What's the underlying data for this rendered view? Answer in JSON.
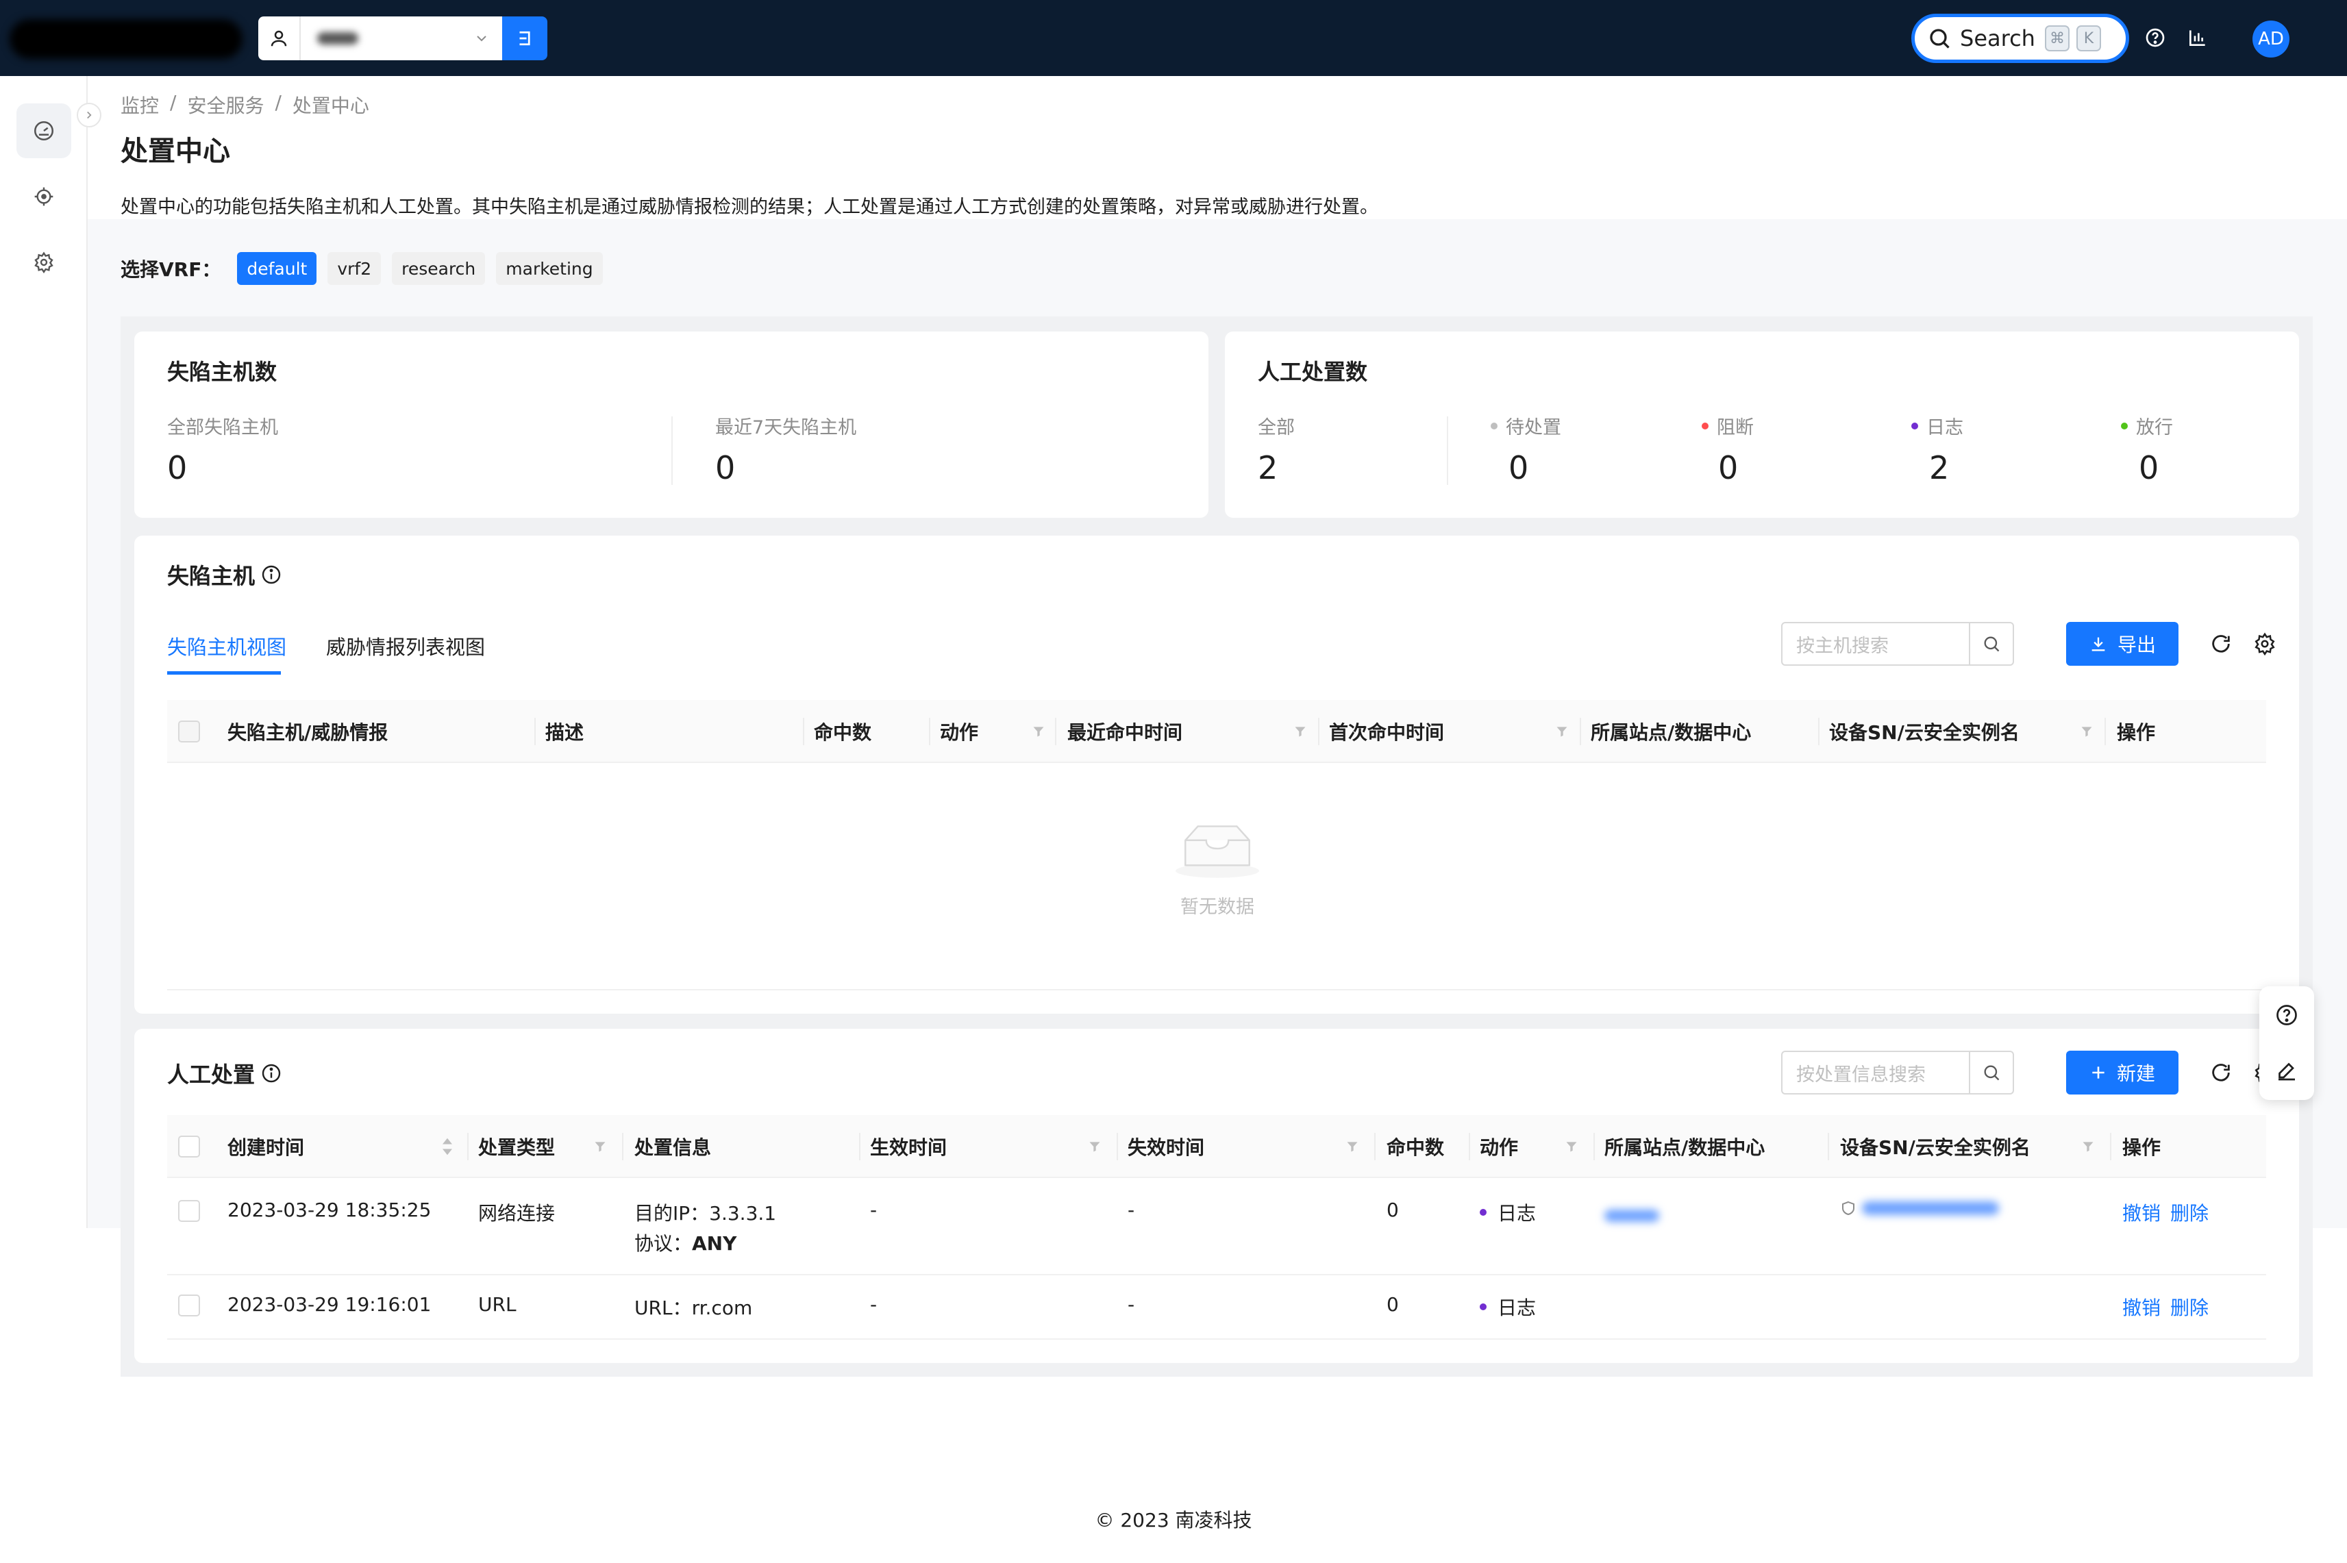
{
  "topbar": {
    "tenant_value": "test",
    "search_label": "Search",
    "search_kbd": [
      "⌘",
      "K"
    ],
    "avatar_text": "AD"
  },
  "breadcrumb": [
    "监控",
    "/",
    "安全服务",
    "/",
    "处置中心"
  ],
  "page": {
    "title": "处置中心",
    "description": "处置中心的功能包括失陷主机和人工处置。其中失陷主机是通过威胁情报检测的结果；人工处置是通过人工方式创建的处置策略，对异常或威胁进行处置。"
  },
  "vrf": {
    "label": "选择VRF：",
    "options": [
      "default",
      "vrf2",
      "research",
      "marketing"
    ],
    "selected": "default"
  },
  "stats_hosts": {
    "title": "失陷主机数",
    "items": [
      {
        "label": "全部失陷主机",
        "value": "0"
      },
      {
        "label": "最近7天失陷主机",
        "value": "0"
      }
    ]
  },
  "stats_manual": {
    "title": "人工处置数",
    "items": [
      {
        "label": "全部",
        "value": "2"
      },
      {
        "label": "待处置",
        "value": "0",
        "dot": "#bfbfbf"
      },
      {
        "label": "阻断",
        "value": "0",
        "dot": "#ff4d4f"
      },
      {
        "label": "日志",
        "value": "2",
        "dot": "#722ed1"
      },
      {
        "label": "放行",
        "value": "0",
        "dot": "#52c41a"
      }
    ]
  },
  "hosts": {
    "title": "失陷主机",
    "tabs": [
      "失陷主机视图",
      "威胁情报列表视图"
    ],
    "search_placeholder": "按主机搜索",
    "export_label": "导出",
    "columns": [
      "失陷主机/威胁情报",
      "描述",
      "命中数",
      "动作",
      "最近命中时间",
      "首次命中时间",
      "所属站点/数据中心",
      "设备SN/云安全实例名",
      "操作"
    ],
    "empty_text": "暂无数据"
  },
  "manual": {
    "title": "人工处置",
    "search_placeholder": "按处置信息搜索",
    "new_label": "新建",
    "columns": [
      "创建时间",
      "处置类型",
      "处置信息",
      "生效时间",
      "失效时间",
      "命中数",
      "动作",
      "所属站点/数据中心",
      "设备SN/云安全实例名",
      "操作"
    ],
    "rows": [
      {
        "created": "2023-03-29 18:35:25",
        "type": "网络连接",
        "info_1_label": "目的IP：",
        "info_1_value": "3.3.3.1",
        "info_2_label": "协议：",
        "info_2_value": "ANY",
        "start": "-",
        "end": "-",
        "hits": "0",
        "action": "日志",
        "action_color": "#722ed1",
        "revoke": "撤销",
        "delete": "删除"
      },
      {
        "created": "2023-03-29 19:16:01",
        "type": "URL",
        "info_1_label": "URL：",
        "info_1_value": "rr.com",
        "start": "-",
        "end": "-",
        "hits": "0",
        "action": "日志",
        "action_color": "#722ed1",
        "revoke": "撤销",
        "delete": "删除"
      }
    ]
  },
  "footer": "© 2023 南凌科技"
}
